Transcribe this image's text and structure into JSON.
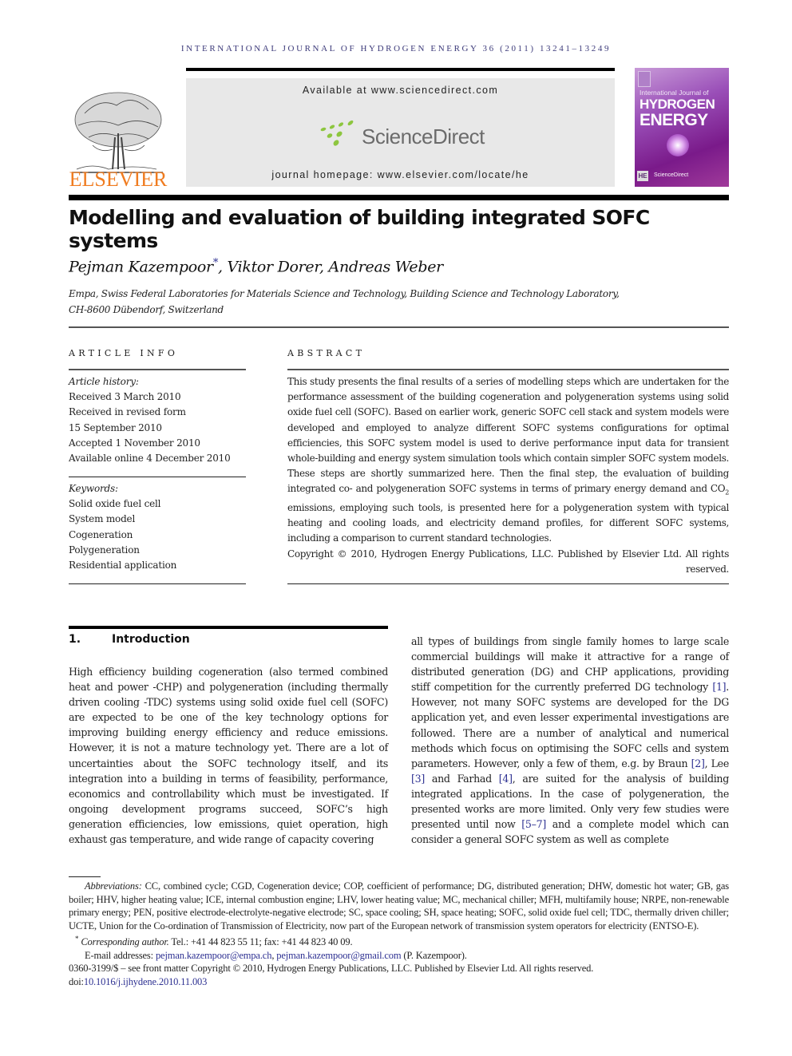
{
  "running_head": "INTERNATIONAL JOURNAL OF HYDROGEN ENERGY 36 (2011) 13241–13249",
  "publisher": {
    "logo_word": "ELSEVIER",
    "available_at": "Available at www.sciencedirect.com",
    "sd_brand": "ScienceDirect",
    "homepage": "journal homepage: www.elsevier.com/locate/he",
    "brand_color": "#f07c20",
    "sd_dot_color": "#8dc63f"
  },
  "cover": {
    "journal_line": "International Journal of",
    "title_line1": "HYDROGEN",
    "title_line2": "ENERGY",
    "badge": "HE",
    "sd_label": "ScienceDirect"
  },
  "article": {
    "title": "Modelling and evaluation of building integrated SOFC systems",
    "authors": "Pejman Kazempoor",
    "author_mark": "*",
    "authors_rest": ", Viktor Dorer, Andreas Weber",
    "affiliation_line1": "Empa, Swiss Federal Laboratories for Materials Science and Technology, Building Science and Technology Laboratory,",
    "affiliation_line2": "CH-8600 Dübendorf, Switzerland"
  },
  "article_info": {
    "heading": "ARTICLE INFO",
    "history_label": "Article history:",
    "history": [
      "Received 3 March 2010",
      "Received in revised form",
      "15 September 2010",
      "Accepted 1 November 2010",
      "Available online 4 December 2010"
    ],
    "keywords_label": "Keywords:",
    "keywords": [
      "Solid oxide fuel cell",
      "System model",
      "Cogeneration",
      "Polygeneration",
      "Residential application"
    ]
  },
  "abstract": {
    "heading": "ABSTRACT",
    "text_a": "This study presents the final results of a series of modelling steps which are undertaken for the performance assessment of the building cogeneration and polygeneration systems using solid oxide fuel cell (SOFC). Based on earlier work, generic SOFC cell stack and system models were developed and employed to analyze different SOFC systems configurations for optimal efficiencies, this SOFC system model is used to derive performance input data for transient whole-building and energy system simulation tools which contain simpler SOFC system models. These steps are shortly summarized here. Then the final step, the evaluation of building integrated co- and polygeneration SOFC systems in terms of primary energy demand and CO",
    "subscript": "2",
    "text_b": " emissions, employing such tools, is presented here for a polygeneration system with typical heating and cooling loads, and electricity demand profiles, for different SOFC systems, including a comparison to current standard technologies.",
    "copyright_a": "Copyright © 2010, Hydrogen Energy Publications, LLC. Published by Elsevier Ltd. All rights",
    "copyright_b": "reserved."
  },
  "intro": {
    "number": "1.",
    "heading": "Introduction",
    "left_text": "High efficiency building cogeneration (also termed combined heat and power -CHP) and polygeneration (including thermally driven cooling -TDC) systems using solid oxide fuel cell (SOFC) are expected to be one of the key technology options for improving building energy efficiency and reduce emissions. However, it is not a mature technology yet. There are a lot of uncertainties about the SOFC technology itself, and its integration into a building in terms of feasibility, performance, economics and controllability which must be investigated. If ongoing development programs succeed, SOFC’s high generation efficiencies, low emissions, quiet operation, high exhaust gas temperature, and wide range of capacity covering",
    "right_1": "all types of buildings from single family homes to large scale commercial buildings will make it attractive for a range of distributed generation (DG) and CHP applications, providing stiff competition for the currently preferred DG technology ",
    "ref_1": "[1]",
    "right_2": ". However, not many SOFC systems are developed for the DG application yet, and even lesser experimental investigations are followed. There are a number of analytical and numerical methods which focus on optimising the SOFC cells and system parameters. However, only a few of them, e.g. by Braun ",
    "ref_2": "[2]",
    "right_3": ", Lee ",
    "ref_3": "[3]",
    "right_4": " and Farhad ",
    "ref_4": "[4]",
    "right_5": ", are suited for the analysis of building integrated applications. In the case of polygeneration, the presented works are more limited. Only very few studies were presented until now ",
    "ref_5": "[5–7]",
    "right_6": " and a complete model which can consider a general SOFC system as well as complete"
  },
  "footnotes": {
    "abbr_label": "Abbreviations:",
    "abbr_text": " CC, combined cycle; CGD, Cogeneration device; COP, coefficient of performance; DG, distributed generation; DHW, domestic hot water; GB, gas boiler; HHV, higher heating value; ICE, internal combustion engine; LHV, lower heating value; MC, mechanical chiller; MFH, multifamily house; NRPE, non-renewable primary energy; PEN, positive electrode-electrolyte-negative electrode; SC, space cooling; SH, space heating; SOFC, solid oxide fuel cell; TDC, thermally driven chiller; UCTE, Union for the Co-ordination of Transmission of Electricity, now part of the European network of transmission system operators for electricity (ENTSO-E).",
    "corr_mark": "*",
    "corr_label": "Corresponding author.",
    "corr_text": " Tel.: +41 44 823 55 11; fax: +41 44 823 40 09.",
    "email_label": "E-mail addresses: ",
    "email_1": "pejman.kazempoor@empa.ch",
    "email_sep": ", ",
    "email_2": "pejman.kazempoor@gmail.com",
    "email_owner": " (P. Kazempoor).",
    "front_matter": "0360-3199/$ – see front matter Copyright © 2010, Hydrogen Energy Publications, LLC. Published by Elsevier Ltd. All rights reserved.",
    "doi_label": "doi:",
    "doi": "10.1016/j.ijhydene.2010.11.003"
  }
}
